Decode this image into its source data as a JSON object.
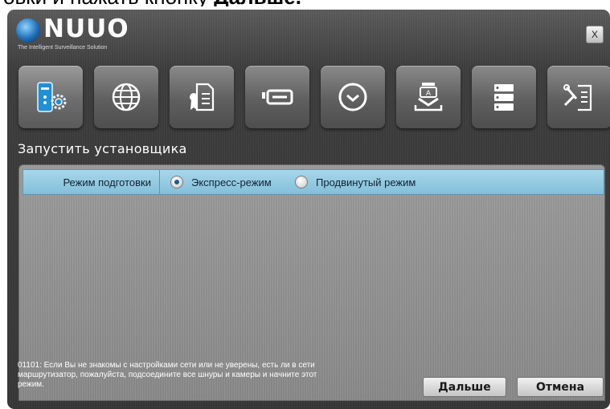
{
  "doc_caption": {
    "prefix": "овки и нажать кнопку ",
    "bold": "Дальше."
  },
  "window": {
    "logo_text": "NUUO",
    "logo_tagline": "The Intelligent Surveillance Solution",
    "close_label": "X"
  },
  "steps": [
    {
      "icon": "server-settings-icon",
      "active": true
    },
    {
      "icon": "globe-icon",
      "active": false
    },
    {
      "icon": "license-certificate-icon",
      "active": false
    },
    {
      "icon": "storage-drive-icon",
      "active": false
    },
    {
      "icon": "clock-icon",
      "active": false
    },
    {
      "icon": "download-install-icon",
      "active": false
    },
    {
      "icon": "server-rack-icon",
      "active": false
    },
    {
      "icon": "tools-document-icon",
      "active": false
    }
  ],
  "heading": "Запустить установщика",
  "mode_row": {
    "label": "Режим подготовки",
    "options": [
      {
        "label": "Экспресс-режим",
        "checked": true
      },
      {
        "label": "Продвинутый режим",
        "checked": false
      }
    ]
  },
  "hint": "01101: Если Вы не знакомы с настройками сети или не уверены, есть ли в сети маршрутизатор, пожалуйста, подсоедините все шнуры и камеры и начните этот режим.",
  "buttons": {
    "next": "Дальше",
    "cancel": "Отмена"
  },
  "colors": {
    "accent_row": "#94c9e0",
    "window_bg": "#3e3e3e",
    "icon_blue": "#1f8fd6"
  }
}
